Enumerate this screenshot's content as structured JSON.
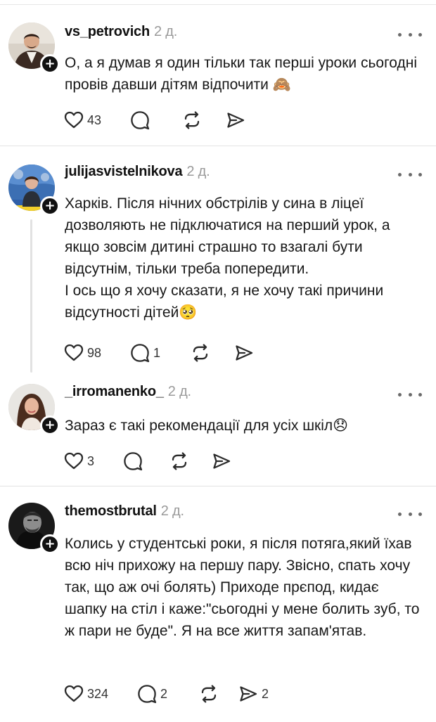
{
  "posts": [
    {
      "username": "vs_petrovich",
      "time": "2 д.",
      "text": [
        "О, а я думав я один тільки так перші уроки сьогодні провів давши дітям відпочити 🙈"
      ],
      "likes": "43",
      "replies": "",
      "reposts": "",
      "shares": ""
    },
    {
      "username": "julijasvistelnikova",
      "time": "2 д.",
      "text": [
        "Харків. Після нічних обстрілів у сина в ліцеї дозволяють не підключатися на перший урок, а якщо зовсім дитині страшно то взагалі бути відсутнім, тільки треба попередити.",
        "І ось що я хочу сказати, я не хочу такі причини відсутності дітей🥺"
      ],
      "likes": "98",
      "replies": "1",
      "reposts": "",
      "shares": ""
    },
    {
      "username": "_irromanenko_",
      "time": "2 д.",
      "text": [
        "Зараз є такі рекомендації для усіх шкіл😞"
      ],
      "likes": "3",
      "replies": "",
      "reposts": "",
      "shares": ""
    },
    {
      "username": "themostbrutal",
      "time": "2 д.",
      "text": [
        "Колись у студентські роки, я після потяга,який їхав всю ніч прихожу на першу пару. Звісно, спать хочу так, що аж очі болять) Приходе прєпод, кидає шапку на стіл і каже:\"сьогодні у мене болить зуб, то ж пари не буде\". Я на все життя запам'ятав."
      ],
      "likes": "324",
      "replies": "2",
      "reposts": "",
      "shares": "2"
    }
  ],
  "icons": {
    "like": "heart-icon",
    "reply": "comment-icon",
    "repost": "repost-icon",
    "share": "send-icon",
    "more": "more-dots-icon",
    "follow": "plus-icon"
  },
  "colors": {
    "text": "#181818",
    "muted": "#9a9a9a",
    "divider": "#e3e3e3",
    "icon": "#2b2b2b"
  }
}
